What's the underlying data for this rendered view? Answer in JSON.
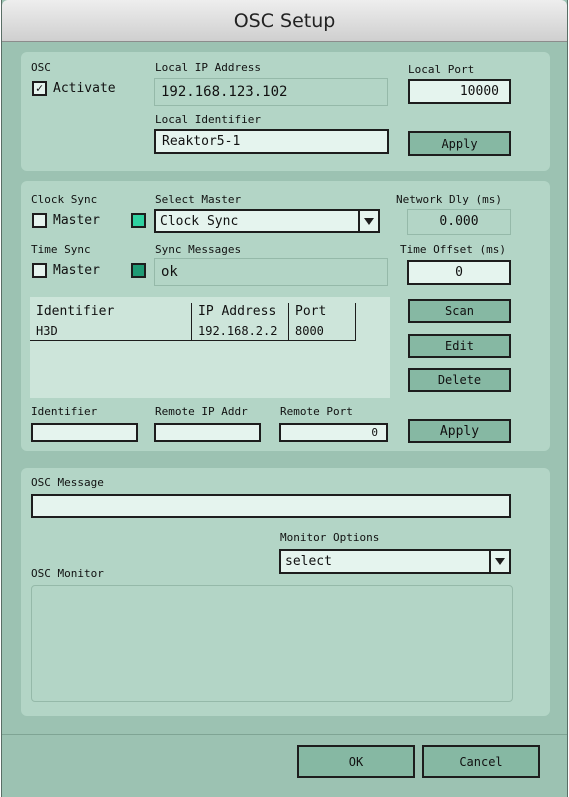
{
  "window": {
    "title": "OSC Setup"
  },
  "osc": {
    "section_label": "OSC",
    "activate_label": "Activate",
    "activate_checked": true,
    "checkmark": "✓",
    "local_ip_label": "Local IP Address",
    "local_ip_value": "192.168.123.102",
    "local_port_label": "Local Port",
    "local_port_value": "10000",
    "local_identifier_label": "Local Identifier",
    "local_identifier_value": "Reaktor5-1",
    "apply_label": "Apply"
  },
  "sync": {
    "clock_sync_label": "Clock Sync",
    "clock_master_label": "Master",
    "select_master_label": "Select Master",
    "select_master_value": "Clock Sync",
    "network_dly_label": "Network Dly (ms)",
    "network_dly_value": "0.000",
    "time_sync_label": "Time Sync",
    "time_master_label": "Master",
    "sync_messages_label": "Sync Messages",
    "sync_messages_value": "ok",
    "time_offset_label": "Time Offset (ms)",
    "time_offset_value": "0",
    "led_colors": {
      "clock": "#2fd1a0",
      "time": "#1f9a74"
    }
  },
  "remotes": {
    "columns": [
      "Identifier",
      "IP Address",
      "Port"
    ],
    "rows": [
      {
        "identifier": "H3D",
        "ip": "192.168.2.2",
        "port": "8000"
      }
    ],
    "scan_label": "Scan",
    "edit_label": "Edit",
    "delete_label": "Delete",
    "identifier_label": "Identifier",
    "identifier_value": "",
    "remote_ip_label": "Remote IP Addr",
    "remote_ip_value": "",
    "remote_port_label": "Remote Port",
    "remote_port_value": "0",
    "apply_label": "Apply"
  },
  "messages": {
    "osc_message_label": "OSC Message",
    "osc_message_value": "",
    "monitor_options_label": "Monitor Options",
    "monitor_options_value": "select",
    "osc_monitor_label": "OSC Monitor"
  },
  "footer": {
    "ok_label": "OK",
    "cancel_label": "Cancel"
  }
}
